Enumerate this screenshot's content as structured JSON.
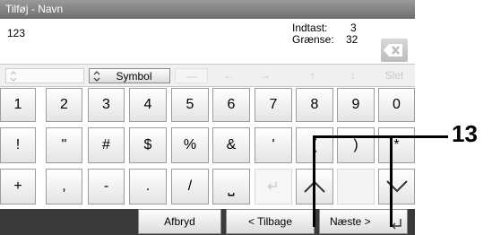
{
  "window": {
    "title": "Tilføj - Navn"
  },
  "entry": {
    "value": "123",
    "input_label": "Indtast:",
    "input_count": "3",
    "limit_label": "Grænse:",
    "limit_count": "32"
  },
  "toolbar": {
    "symbol_label": "Symbol",
    "space_label": "—",
    "left_arrow": "←",
    "right_arrow": "→",
    "up_arrow": "↑",
    "down_arrow": "↓",
    "delete_label": "Slet"
  },
  "keyboard": {
    "row1": [
      "1",
      "2",
      "3",
      "4",
      "5",
      "6",
      "7",
      "8",
      "9",
      "0"
    ],
    "row2": [
      "!",
      "\"",
      "#",
      "$",
      "%",
      "&",
      "'",
      "(",
      ")",
      "*"
    ],
    "row3": [
      "+",
      ",",
      "-",
      ".",
      "/",
      "⎵",
      "↵",
      "",
      "",
      ""
    ]
  },
  "footer": {
    "cancel_label": "Afbryd",
    "back_label": "< Tilbage",
    "next_label": "Næste >"
  },
  "callout": {
    "number": "13"
  },
  "colors": {
    "title_bar": "#808080",
    "footer_bg": "#3a3a3a",
    "disabled": "#c8c8c8"
  }
}
